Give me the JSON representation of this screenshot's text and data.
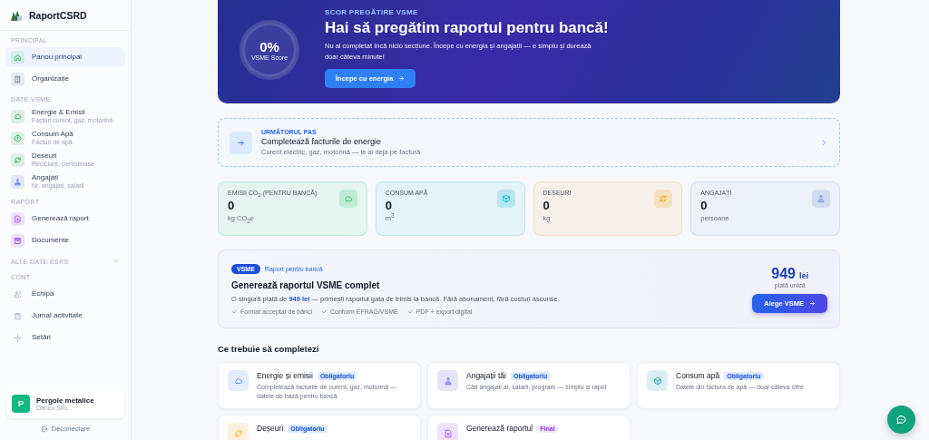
{
  "sidebar": {
    "brand": "RaportCSRD",
    "sections": [
      {
        "title": "PRINCIPAL",
        "items": [
          {
            "label": "Panou principal",
            "selected": true
          },
          {
            "label": "Organizație",
            "selected": false
          }
        ]
      },
      {
        "title": "DATE VSME",
        "items": [
          {
            "label": "Energie & Emisii",
            "sublabel": "Facturi curent, gaz, motorină",
            "selected": false
          },
          {
            "label": "Consum Apă",
            "sublabel": "Facturi de apă",
            "selected": false
          },
          {
            "label": "Deșeuri",
            "sublabel": "Reciclare, periculoase",
            "selected": false
          },
          {
            "label": "Angajați",
            "sublabel": "Nr. angajați, salarii",
            "selected": false
          }
        ]
      },
      {
        "title": "RAPORT",
        "items": [
          {
            "label": "Generează raport",
            "selected": false
          },
          {
            "label": "Documente",
            "selected": false
          }
        ]
      },
      {
        "title": "ALTE DATE ESRS",
        "expanded": false
      },
      {
        "title": "CONT",
        "items": [
          {
            "label": "Echipa",
            "selected": false
          },
          {
            "label": "Jurnal activitate",
            "selected": false
          },
          {
            "label": "Setări",
            "selected": false
          }
        ]
      }
    ],
    "organization": {
      "initial": "P",
      "name": "Pergole metalice",
      "company": "Dancu SRL"
    },
    "logout": "Deconectare"
  },
  "hero": {
    "score": "0%",
    "score_label": "VSME Score",
    "level": 0,
    "eyebrow": "SCOR PREGĂTIRE VSME",
    "title": "Hai să pregătim raportul pentru bancă!",
    "text": "Nu ai completat încă nicio secțiune. Începe cu energia și angajații — e simplu și durează doar câteva minute!",
    "button": "Începe cu energia"
  },
  "next_step": {
    "eyebrow": "URMĂTORUL PAS",
    "title": "Completează facturile de energie",
    "subtitle": "Curent electric, gaz, motorină — le ai deja pe factură"
  },
  "stats": [
    {
      "label": "EMISII CO$_{2}$ (PENTRU BANCĂ)",
      "value": "0",
      "unit": "kg CO$_{2}$e"
    },
    {
      "label": "CONSUM APĂ",
      "value": "0",
      "unit": "m$^{3}$"
    },
    {
      "label": "DEȘEURI",
      "value": "0",
      "unit": "kg"
    },
    {
      "label": "ANGAJAȚI",
      "value": "0",
      "unit": "persoane"
    }
  ],
  "offer": {
    "badge": "VSME",
    "tag": "Raport pentru bancă",
    "title": "Generează raportul VSME complet",
    "text": "O singură plată de **949 lei** — primești raportul gata de trimis la bancă. Fără abonament, fără costuri ascunse.",
    "features": [
      "Format acceptat de bănci",
      "Conform EFRAG/VSME",
      "PDF + export digital"
    ],
    "price": "949",
    "currency": "lei",
    "price_note": "plată unică",
    "button": "Alege VSME"
  },
  "tasks": {
    "title": "Ce trebuie să completezi",
    "items": [
      {
        "title": "Energie și emisii",
        "badge": "Obligatoriu",
        "kind": "required",
        "text": "Completează facturile de curent, gaz, motorină — datele de bază pentru bancă"
      },
      {
        "title": "Angajații tăi",
        "badge": "Obligatoriu",
        "kind": "required",
        "text": "Câți angajați ai, salarii, program — simplu și rapid"
      },
      {
        "title": "Consum apă",
        "badge": "Obligatoriu",
        "kind": "required",
        "text": "Datele din factura de apă — doar câteva cifre"
      },
      {
        "title": "Deșeuri",
        "badge": "Obligatoriu",
        "kind": "required"
      },
      {
        "title": "Generează raportul",
        "badge": "Final",
        "kind": "final"
      }
    ]
  }
}
